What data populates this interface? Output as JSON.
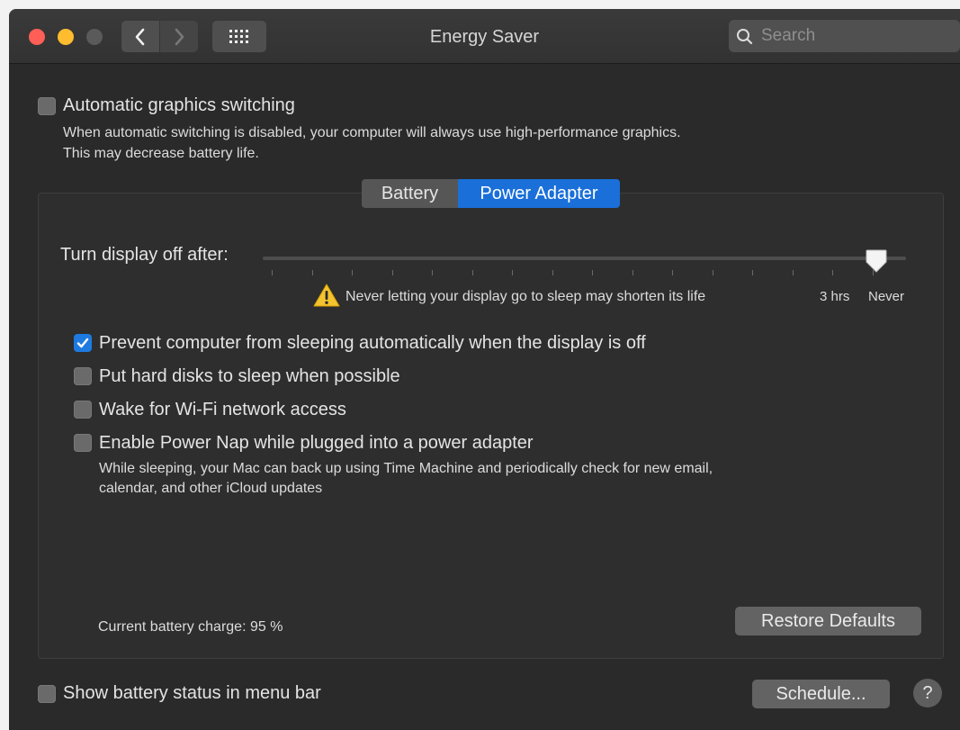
{
  "window": {
    "title": "Energy Saver"
  },
  "search": {
    "placeholder": "Search"
  },
  "graphics": {
    "label": "Automatic graphics switching",
    "checked": false,
    "description_line1": "When automatic switching is disabled, your computer will always use high-performance graphics.",
    "description_line2": "This may decrease battery life."
  },
  "tabs": [
    {
      "label": "Battery",
      "selected": false
    },
    {
      "label": "Power Adapter",
      "selected": true
    }
  ],
  "display_sleep": {
    "label": "Turn display off after:",
    "warning": "Never letting your display go to sleep may shorten its life",
    "tick_labels": [
      "3 hrs",
      "Never"
    ],
    "value": "Never"
  },
  "options": [
    {
      "label": "Prevent computer from sleeping automatically when the display is off",
      "checked": true
    },
    {
      "label": "Put hard disks to sleep when possible",
      "checked": false
    },
    {
      "label": "Wake for Wi-Fi network access",
      "checked": false
    },
    {
      "label": "Enable Power Nap while plugged into a power adapter",
      "checked": false
    }
  ],
  "power_nap_description": {
    "line1": "While sleeping, your Mac can back up using Time Machine and periodically check for new email,",
    "line2": "calendar, and other iCloud updates"
  },
  "battery_charge": "Current battery charge: 95 %",
  "buttons": {
    "restore_defaults": "Restore Defaults",
    "schedule": "Schedule...",
    "help": "?"
  },
  "menu_bar_status": {
    "label": "Show battery status in menu bar",
    "checked": false
  },
  "colors": {
    "accent": "#1a6fd9",
    "background": "#2a2a2a",
    "close": "#ff5f57",
    "minimize": "#febc2e"
  }
}
